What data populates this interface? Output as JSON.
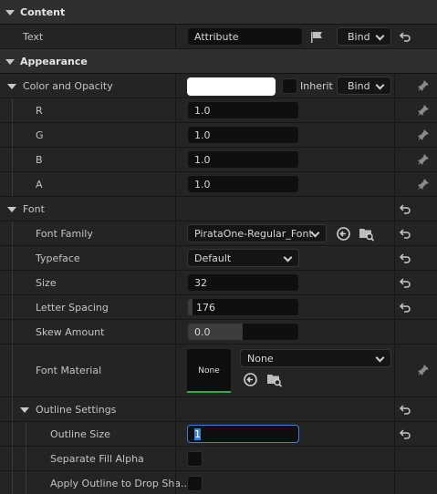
{
  "sections": {
    "content": "Content",
    "appearance": "Appearance"
  },
  "text_prop": {
    "name": "Text",
    "value": "Attribute",
    "bind": "Bind"
  },
  "color": {
    "name": "Color and Opacity",
    "inherit": "Inherit",
    "bind": "Bind",
    "swatch": "#ffffff"
  },
  "channels": [
    {
      "name": "R",
      "value": "1.0"
    },
    {
      "name": "G",
      "value": "1.0"
    },
    {
      "name": "B",
      "value": "1.0"
    },
    {
      "name": "A",
      "value": "1.0"
    }
  ],
  "font": {
    "name": "Font",
    "family_label": "Font Family",
    "family_value": "PirataOne-Regular_Font",
    "typeface_label": "Typeface",
    "typeface_value": "Default",
    "size_label": "Size",
    "size_value": "32",
    "spacing_label": "Letter Spacing",
    "spacing_value": "176",
    "skew_label": "Skew Amount",
    "skew_value": "0.0",
    "material_label": "Font Material",
    "material_preview": "None",
    "material_value": "None",
    "outline_label": "Outline Settings",
    "outline_size_label": "Outline Size",
    "outline_size_value": "1",
    "sep_fill_label": "Separate Fill Alpha",
    "drop_shadow_label": "Apply Outline to Drop Sha..."
  },
  "icons": {
    "reset": "reset-arrow-icon",
    "pin": "pin-icon",
    "flag": "flag-icon",
    "browse": "browse-icon",
    "use-selected": "use-selected-icon"
  },
  "colors": {
    "accent_green": "#3aa64a",
    "focus_blue": "#3b7fd6"
  }
}
